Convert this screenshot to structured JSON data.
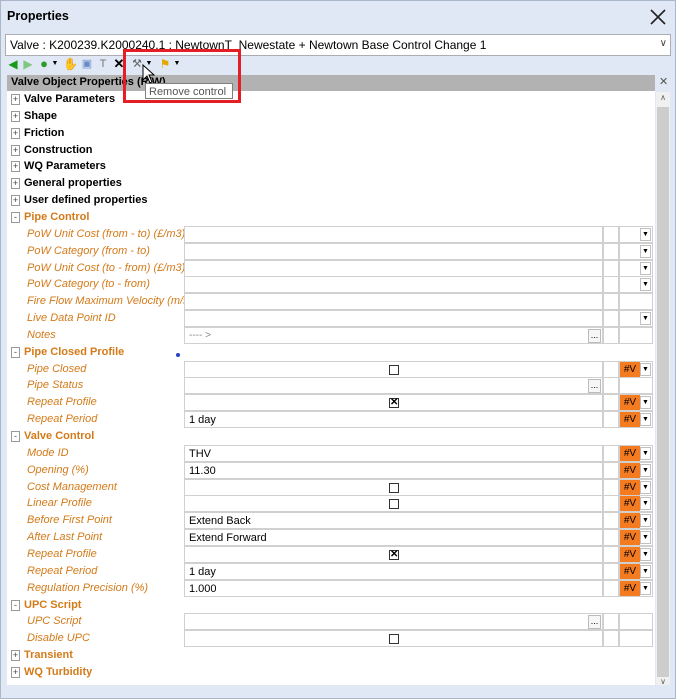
{
  "window": {
    "title": "Properties"
  },
  "object_selector": {
    "value": "Valve : K200239.K2000240.1 : NewtownT_Newestate + Newtown Base Control Change 1"
  },
  "toolbar": {
    "tooltip": "Remove control"
  },
  "grid": {
    "header": "Valve Object Properties (R/W)",
    "rows": [
      {
        "type": "section",
        "label": "Valve Parameters",
        "color": "black",
        "expander": "+"
      },
      {
        "type": "section",
        "label": "Shape",
        "color": "black",
        "expander": "+"
      },
      {
        "type": "section",
        "label": "Friction",
        "color": "black",
        "expander": "+"
      },
      {
        "type": "section",
        "label": "Construction",
        "color": "black",
        "expander": "+"
      },
      {
        "type": "section",
        "label": "WQ Parameters",
        "color": "black",
        "expander": "+"
      },
      {
        "type": "section",
        "label": "General properties",
        "color": "black",
        "expander": "+"
      },
      {
        "type": "section",
        "label": "User defined properties",
        "color": "black",
        "expander": "+"
      },
      {
        "type": "section",
        "label": "Pipe Control",
        "color": "orange",
        "expander": "-"
      },
      {
        "type": "prop",
        "label": "PoW Unit Cost (from - to) (£/m3)",
        "value": "",
        "dropdown": true
      },
      {
        "type": "prop",
        "label": "PoW Category (from - to)",
        "value": "",
        "dropdown": true
      },
      {
        "type": "prop",
        "label": "PoW Unit Cost (to - from) (£/m3)",
        "value": "",
        "dropdown": true
      },
      {
        "type": "prop",
        "label": "PoW Category (to - from)",
        "value": "",
        "dropdown": true
      },
      {
        "type": "prop",
        "label": "Fire Flow Maximum Velocity (m/s)",
        "value": ""
      },
      {
        "type": "prop",
        "label": "Live Data Point ID",
        "value": "",
        "dropdown": true
      },
      {
        "type": "prop",
        "label": "Notes",
        "value": "---- >",
        "ellipsis": true
      },
      {
        "type": "section",
        "label": "Pipe Closed Profile",
        "color": "orange",
        "expander": "-"
      },
      {
        "type": "prop",
        "label": "Pipe Closed",
        "checkbox": false,
        "hashv": true
      },
      {
        "type": "prop",
        "label": "Pipe Status",
        "value": "",
        "ellipsis": true
      },
      {
        "type": "prop",
        "label": "Repeat Profile",
        "checkbox": true,
        "hashv": true
      },
      {
        "type": "prop",
        "label": "Repeat Period",
        "value": "1 day",
        "hashv": true
      },
      {
        "type": "section",
        "label": "Valve Control",
        "color": "orange",
        "expander": "-"
      },
      {
        "type": "prop",
        "label": "Mode ID",
        "value": "THV",
        "hashv": true
      },
      {
        "type": "prop",
        "label": "Opening (%)",
        "value": "11.30",
        "hashv": true
      },
      {
        "type": "prop",
        "label": "Cost Management",
        "checkbox": false,
        "hashv": true
      },
      {
        "type": "prop",
        "label": "Linear Profile",
        "checkbox": false,
        "hashv": true
      },
      {
        "type": "prop",
        "label": "Before First Point",
        "value": "Extend Back",
        "hashv": true
      },
      {
        "type": "prop",
        "label": "After Last Point",
        "value": "Extend Forward",
        "hashv": true
      },
      {
        "type": "prop",
        "label": "Repeat Profile",
        "checkbox": true,
        "hashv": true
      },
      {
        "type": "prop",
        "label": "Repeat Period",
        "value": "1 day",
        "hashv": true
      },
      {
        "type": "prop",
        "label": "Regulation Precision (%)",
        "value": "1.000",
        "hashv": true
      },
      {
        "type": "section",
        "label": "UPC Script",
        "color": "orange",
        "expander": "-"
      },
      {
        "type": "prop",
        "label": "UPC Script",
        "value": "",
        "ellipsis": true
      },
      {
        "type": "prop",
        "label": "Disable UPC",
        "checkbox": false
      },
      {
        "type": "section",
        "label": "Transient",
        "color": "orange",
        "expander": "+"
      },
      {
        "type": "section",
        "label": "WQ Turbidity",
        "color": "orange",
        "expander": "+"
      }
    ],
    "hashv_label": "#V"
  },
  "colors": {
    "orange_text": "#d37a19",
    "hashv_bg": "#f47b20",
    "highlight": "#e51e25"
  }
}
